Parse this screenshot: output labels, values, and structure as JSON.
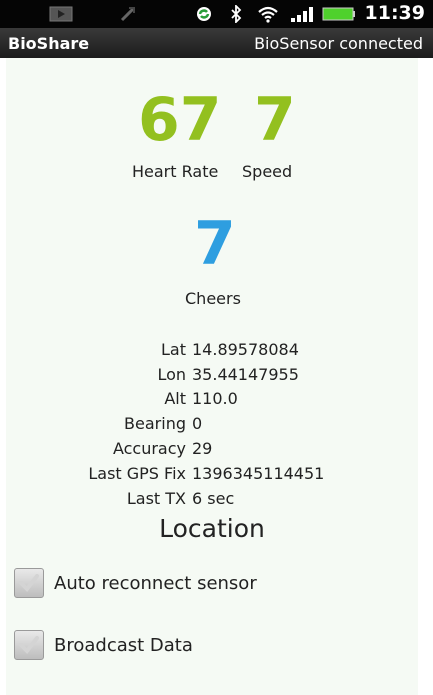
{
  "status_bar": {
    "time": "11:39",
    "icons": [
      "media-icon",
      "signal-off-icon",
      "sync-icon",
      "bluetooth-icon",
      "wifi-icon",
      "cell-signal-icon",
      "battery-icon"
    ]
  },
  "title_bar": {
    "app_name": "BioShare",
    "connection_status": "BioSensor connected"
  },
  "metrics": {
    "heart_rate": {
      "value": "67",
      "label": "Heart Rate"
    },
    "speed": {
      "value": "7",
      "label": "Speed"
    },
    "cheers": {
      "value": "7",
      "label": "Cheers"
    }
  },
  "gps": {
    "rows": [
      {
        "key": "Lat",
        "value": "14.89578084"
      },
      {
        "key": "Lon",
        "value": "35.44147955"
      },
      {
        "key": "Alt",
        "value": "110.0"
      },
      {
        "key": "Bearing",
        "value": "0"
      },
      {
        "key": "Accuracy",
        "value": "29"
      },
      {
        "key": "Last GPS Fix",
        "value": "1396345114451"
      },
      {
        "key": "Last TX",
        "value": "6 sec"
      }
    ]
  },
  "section_title": "Location",
  "options": [
    {
      "label": "Auto reconnect sensor",
      "checked": true
    },
    {
      "label": "Broadcast Data",
      "checked": true
    }
  ],
  "colors": {
    "metric_green": "#93c01f",
    "metric_blue": "#2e9ee0",
    "background": "#f5faf4"
  }
}
